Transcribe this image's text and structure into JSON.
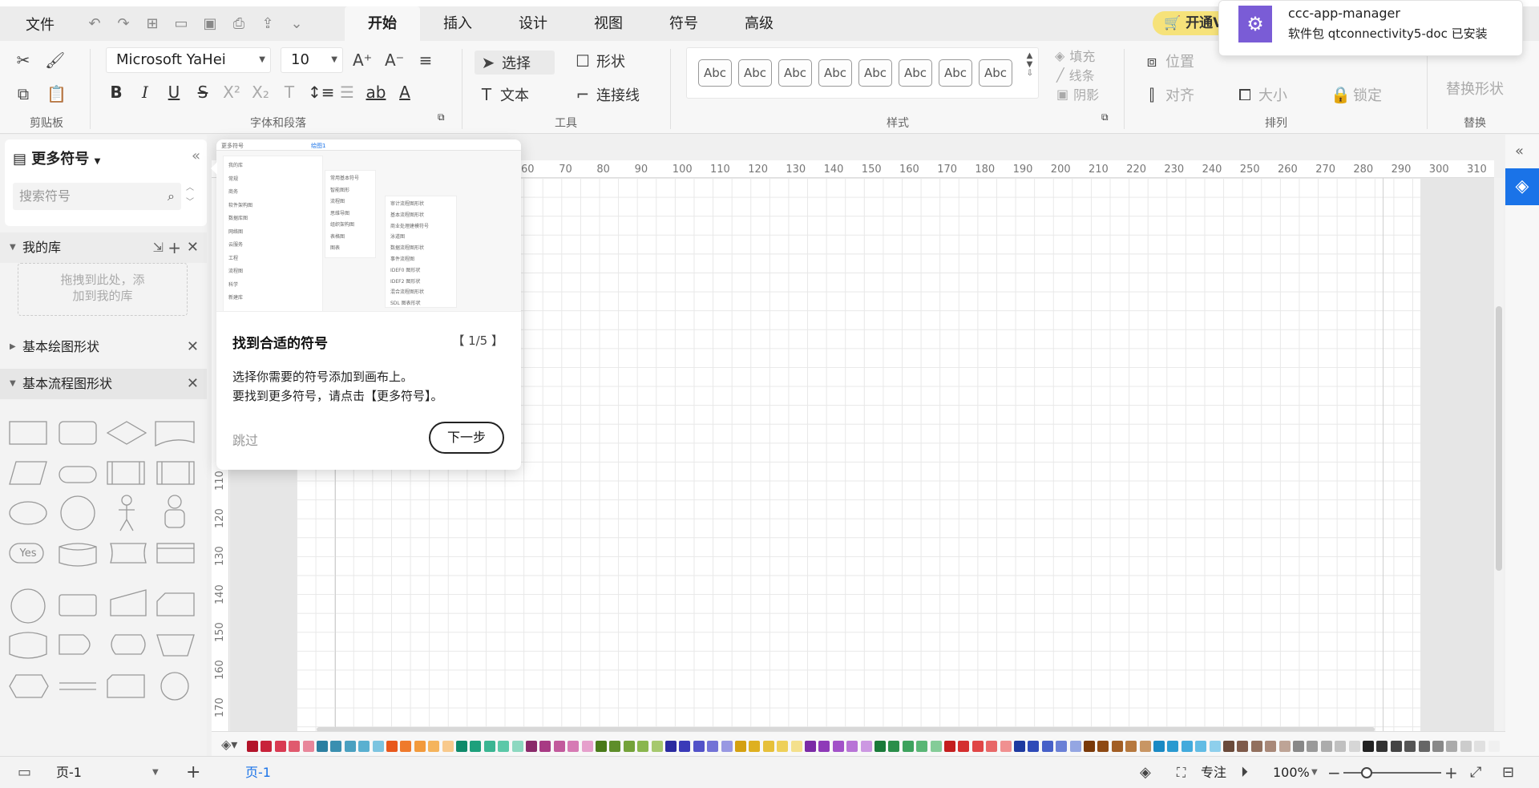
{
  "menubar": {
    "file": "文件",
    "tabs": [
      "开始",
      "插入",
      "设计",
      "视图",
      "符号",
      "高级"
    ],
    "active_tab": "开始",
    "vip": "开通VIP"
  },
  "ribbon": {
    "clipboard_label": "剪贴板",
    "font_name": "Microsoft YaHei",
    "font_size": "10",
    "font_group_label": "字体和段落",
    "select": "选择",
    "shape": "形状",
    "text": "文本",
    "connector": "连接线",
    "tools_label": "工具",
    "style_samples": [
      "Abc",
      "Abc",
      "Abc",
      "Abc",
      "Abc",
      "Abc",
      "Abc",
      "Abc"
    ],
    "fill": "填充",
    "line": "线条",
    "shadow": "阴影",
    "style_label": "样式",
    "position": "位置",
    "align": "对齐",
    "size": "大小",
    "lock": "锁定",
    "arrange_label": "排列",
    "replace_shape": "替换形状",
    "replace_label": "替换"
  },
  "leftpanel": {
    "more_symbols": "更多符号",
    "search_placeholder": "搜索符号",
    "my_library": "我的库",
    "drop_hint_line1": "拖拽到此处，添",
    "drop_hint_line2": "加到我的库",
    "basic_drawing": "基本绘图形状",
    "basic_flowchart": "基本流程图形状",
    "yes_label": "Yes"
  },
  "ruler": {
    "h_ticks": [
      "60",
      "70",
      "80",
      "90",
      "100",
      "110",
      "120",
      "130",
      "140",
      "150",
      "160",
      "170",
      "180",
      "190",
      "200",
      "210",
      "220",
      "230",
      "240",
      "250",
      "260",
      "270",
      "280",
      "290",
      "300",
      "310"
    ],
    "v_ticks": [
      "110",
      "120",
      "130",
      "140",
      "150",
      "160",
      "170"
    ]
  },
  "tour": {
    "title": "找到合适的符号",
    "counter": "【 1/5 】",
    "line1": "选择你需要的符号添加到画布上。",
    "line2": "要找到更多符号，请点击【更多符号】。",
    "skip": "跳过",
    "next": "下一步",
    "preview": {
      "header": "更多符号",
      "tab": "绘图1",
      "menu1": [
        "我的库",
        "常规",
        "商务",
        "软件架构图",
        "数据库图",
        "网络图",
        "云服务",
        "工程",
        "流程图",
        "科学",
        "新建库"
      ],
      "menu2": [
        "常用基本符号",
        "智能图形",
        "流程图",
        "思维导图",
        "组织架构图",
        "表格图",
        "图表"
      ],
      "menu3": [
        "审计流程图形状",
        "基本流程图形状",
        "商业处理建模符号",
        "泳道图",
        "数据流程图形状",
        "事件流程图",
        "IDEF0 图形状",
        "IDEF2 图形状",
        "混合流程图形状",
        "SDL 图表形状"
      ]
    }
  },
  "notification": {
    "title": "ccc-app-manager",
    "body": "软件包 qtconnectivity5-doc 已安装"
  },
  "palette": {
    "colors": [
      "#b3142a",
      "#c8233a",
      "#d93a52",
      "#e05a6e",
      "#e8869a",
      "#2c7fa0",
      "#3a8fb0",
      "#4aa0c0",
      "#5ab0d0",
      "#7cc4e0",
      "#e8581c",
      "#ef7a2c",
      "#f29a3c",
      "#f5b45c",
      "#f8c98c",
      "#0f8a6a",
      "#1ea07c",
      "#3ab592",
      "#5cc8a8",
      "#8cd8c0",
      "#8a2a6a",
      "#a83a84",
      "#c25a9c",
      "#d67ab4",
      "#e6a0cc",
      "#4a7a1a",
      "#5e8e2a",
      "#74a23a",
      "#8ab64e",
      "#a6c86e",
      "#2a2aa0",
      "#3a3ab8",
      "#5252c8",
      "#7272d6",
      "#9898e2",
      "#d4a010",
      "#deb020",
      "#e6c03a",
      "#eed05a",
      "#f4e08c",
      "#7a2aa6",
      "#8e3ab8",
      "#a252c8",
      "#b874d6",
      "#cc98e2",
      "#1a7a3a",
      "#2a8e4a",
      "#3ea25e",
      "#5ab676",
      "#84cc98",
      "#c41e1e",
      "#d42e2e",
      "#e04646",
      "#e86868",
      "#f09090",
      "#1e3aa0",
      "#2e4ab8",
      "#4660c8",
      "#6a80d6",
      "#94a6e2",
      "#7a3a0a",
      "#8e4a14",
      "#a25e24",
      "#b6783e",
      "#c89664",
      "#1a8ac4",
      "#2a9ad0",
      "#42aadc",
      "#62bce4",
      "#8ecfec",
      "#6a4a3a",
      "#7e5a4a",
      "#92705e",
      "#a88878",
      "#bea496",
      "#888888",
      "#9a9a9a",
      "#acacac",
      "#c0c0c0",
      "#d6d6d6",
      "#222222",
      "#333333",
      "#444444",
      "#555555",
      "#666666",
      "#888888",
      "#aaaaaa",
      "#cccccc",
      "#e0e0e0",
      "#f0f0f0"
    ]
  },
  "statusbar": {
    "page_select": "页-1",
    "page_tab": "页-1",
    "focus": "专注",
    "zoom": "100%"
  }
}
